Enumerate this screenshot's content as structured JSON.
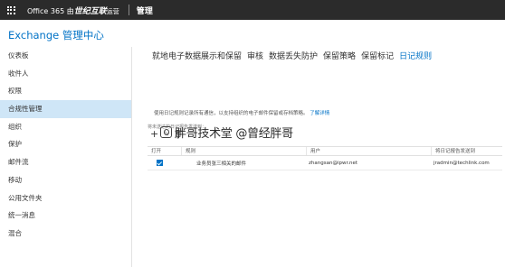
{
  "topbar": {
    "brand_part1": "Office 365 由",
    "brand_part2": "世纪互联",
    "brand_part3": "运营",
    "admin_label": "管理"
  },
  "page": {
    "title": "Exchange 管理中心"
  },
  "sidebar": {
    "items": [
      {
        "label": "仪表板"
      },
      {
        "label": "收件人"
      },
      {
        "label": "权限"
      },
      {
        "label": "合规性管理",
        "active": true
      },
      {
        "label": "组织"
      },
      {
        "label": "保护"
      },
      {
        "label": "邮件流"
      },
      {
        "label": "移动"
      },
      {
        "label": "公用文件夹"
      },
      {
        "label": "统一消息"
      },
      {
        "label": "混合"
      }
    ]
  },
  "tabs": [
    {
      "label": "就地电子数据展示和保留"
    },
    {
      "label": "审核"
    },
    {
      "label": "数据丢失防护"
    },
    {
      "label": "保留策略"
    },
    {
      "label": "保留标记"
    },
    {
      "label": "日记规则",
      "active": true
    }
  ],
  "main": {
    "description": "使用日记规则记录所有通信，以支持组织的电子邮件保留或存档策略。",
    "learn_more": "了解详情",
    "helper_text": "将未送达的日记报告发送到：",
    "toolbar": {
      "add_icon": "+",
      "edit_icon": "✎",
      "delete_icon": "🗑"
    },
    "table": {
      "headers": [
        "打开",
        "规则",
        "用户",
        "将日记报告发送到"
      ],
      "rows": [
        {
          "enabled": true,
          "rule": "业务员张三相关的邮件",
          "user": "zhangsan@ipwr.net",
          "send_to": "jradmin@techlink.com"
        }
      ]
    }
  },
  "watermark": {
    "text": "胖哥技术堂 @曾经胖哥"
  },
  "colors": {
    "topbar_bg": "#2b2b2b",
    "accent": "#0072c6",
    "active_nav_bg": "#cfe6f7"
  }
}
